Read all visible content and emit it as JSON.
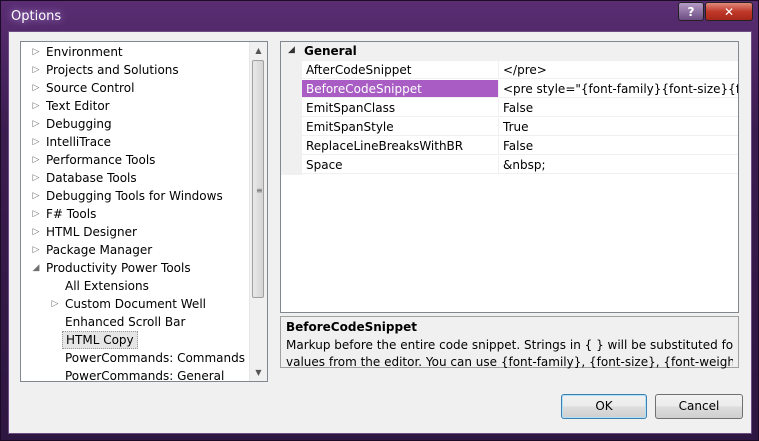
{
  "window": {
    "title": "Options",
    "help_label": "?",
    "close_label": "✕"
  },
  "tree": {
    "items": [
      {
        "label": "Environment",
        "expander": "▷",
        "level": 0
      },
      {
        "label": "Projects and Solutions",
        "expander": "▷",
        "level": 0
      },
      {
        "label": "Source Control",
        "expander": "▷",
        "level": 0
      },
      {
        "label": "Text Editor",
        "expander": "▷",
        "level": 0
      },
      {
        "label": "Debugging",
        "expander": "▷",
        "level": 0
      },
      {
        "label": "IntelliTrace",
        "expander": "▷",
        "level": 0
      },
      {
        "label": "Performance Tools",
        "expander": "▷",
        "level": 0
      },
      {
        "label": "Database Tools",
        "expander": "▷",
        "level": 0
      },
      {
        "label": "Debugging Tools for Windows",
        "expander": "▷",
        "level": 0
      },
      {
        "label": "F# Tools",
        "expander": "▷",
        "level": 0
      },
      {
        "label": "HTML Designer",
        "expander": "▷",
        "level": 0
      },
      {
        "label": "Package Manager",
        "expander": "▷",
        "level": 0
      },
      {
        "label": "Productivity Power Tools",
        "expander": "◢",
        "level": 0
      },
      {
        "label": "All Extensions",
        "expander": "",
        "level": 1
      },
      {
        "label": "Custom Document Well",
        "expander": "▷",
        "level": 1
      },
      {
        "label": "Enhanced Scroll Bar",
        "expander": "",
        "level": 1
      },
      {
        "label": "HTML Copy",
        "expander": "",
        "level": 1,
        "selected": true
      },
      {
        "label": "PowerCommands: Commands",
        "expander": "",
        "level": 1
      },
      {
        "label": "PowerCommands: General",
        "expander": "",
        "level": 1
      }
    ],
    "scroll_up": "▲",
    "scroll_down": "▼",
    "grip": "≡"
  },
  "grid": {
    "category_expander": "◢",
    "category": "General",
    "rows": [
      {
        "name": "AfterCodeSnippet",
        "value": "</pre>"
      },
      {
        "name": "BeforeCodeSnippet",
        "value": "<pre style=\"{font-family}{font-size}{font-weight}\">",
        "selected": true
      },
      {
        "name": "EmitSpanClass",
        "value": "False"
      },
      {
        "name": "EmitSpanStyle",
        "value": "True"
      },
      {
        "name": "ReplaceLineBreaksWithBR",
        "value": "False"
      },
      {
        "name": "Space",
        "value": "&nbsp;"
      }
    ]
  },
  "description": {
    "title": "BeforeCodeSnippet",
    "line1": "Markup before the entire code snippet. Strings in { } will be substituted for actual",
    "line2": "values from the editor. You can use {font-family}, {font-size}, {font-weight}, {font-s..."
  },
  "buttons": {
    "ok": "OK",
    "cancel": "Cancel"
  },
  "colors": {
    "selection": "#a85cc4",
    "titlebar": "#4a2460"
  }
}
